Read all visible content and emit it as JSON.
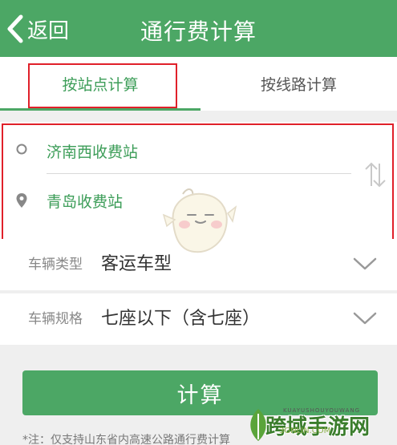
{
  "header": {
    "back_label": "返回",
    "title": "通行费计算"
  },
  "tabs": [
    {
      "label": "按站点计算",
      "active": true
    },
    {
      "label": "按线路计算",
      "active": false
    }
  ],
  "stations": {
    "from": "济南西收费站",
    "to": "青岛收费站"
  },
  "fields": [
    {
      "label": "车辆类型",
      "value": "客运车型"
    },
    {
      "label": "车辆规格",
      "value": "七座以下（含七座）"
    }
  ],
  "calculate_label": "计算",
  "note": "*注：仅支持山东省内高速公路通行费计算",
  "watermark": {
    "cn": "跨域手游网",
    "en": "KUAYUSHOUYOUWANG",
    "site": "3GNLIN.COM"
  },
  "colors": {
    "primary": "#4ca765",
    "accent_text": "#3c9d58",
    "highlight": "#e0202a"
  },
  "icons": {
    "back": "chevron-left-icon",
    "origin": "circle-icon",
    "destination": "location-pin-icon",
    "swap": "swap-vertical-icon",
    "dropdown": "chevron-down-icon"
  }
}
